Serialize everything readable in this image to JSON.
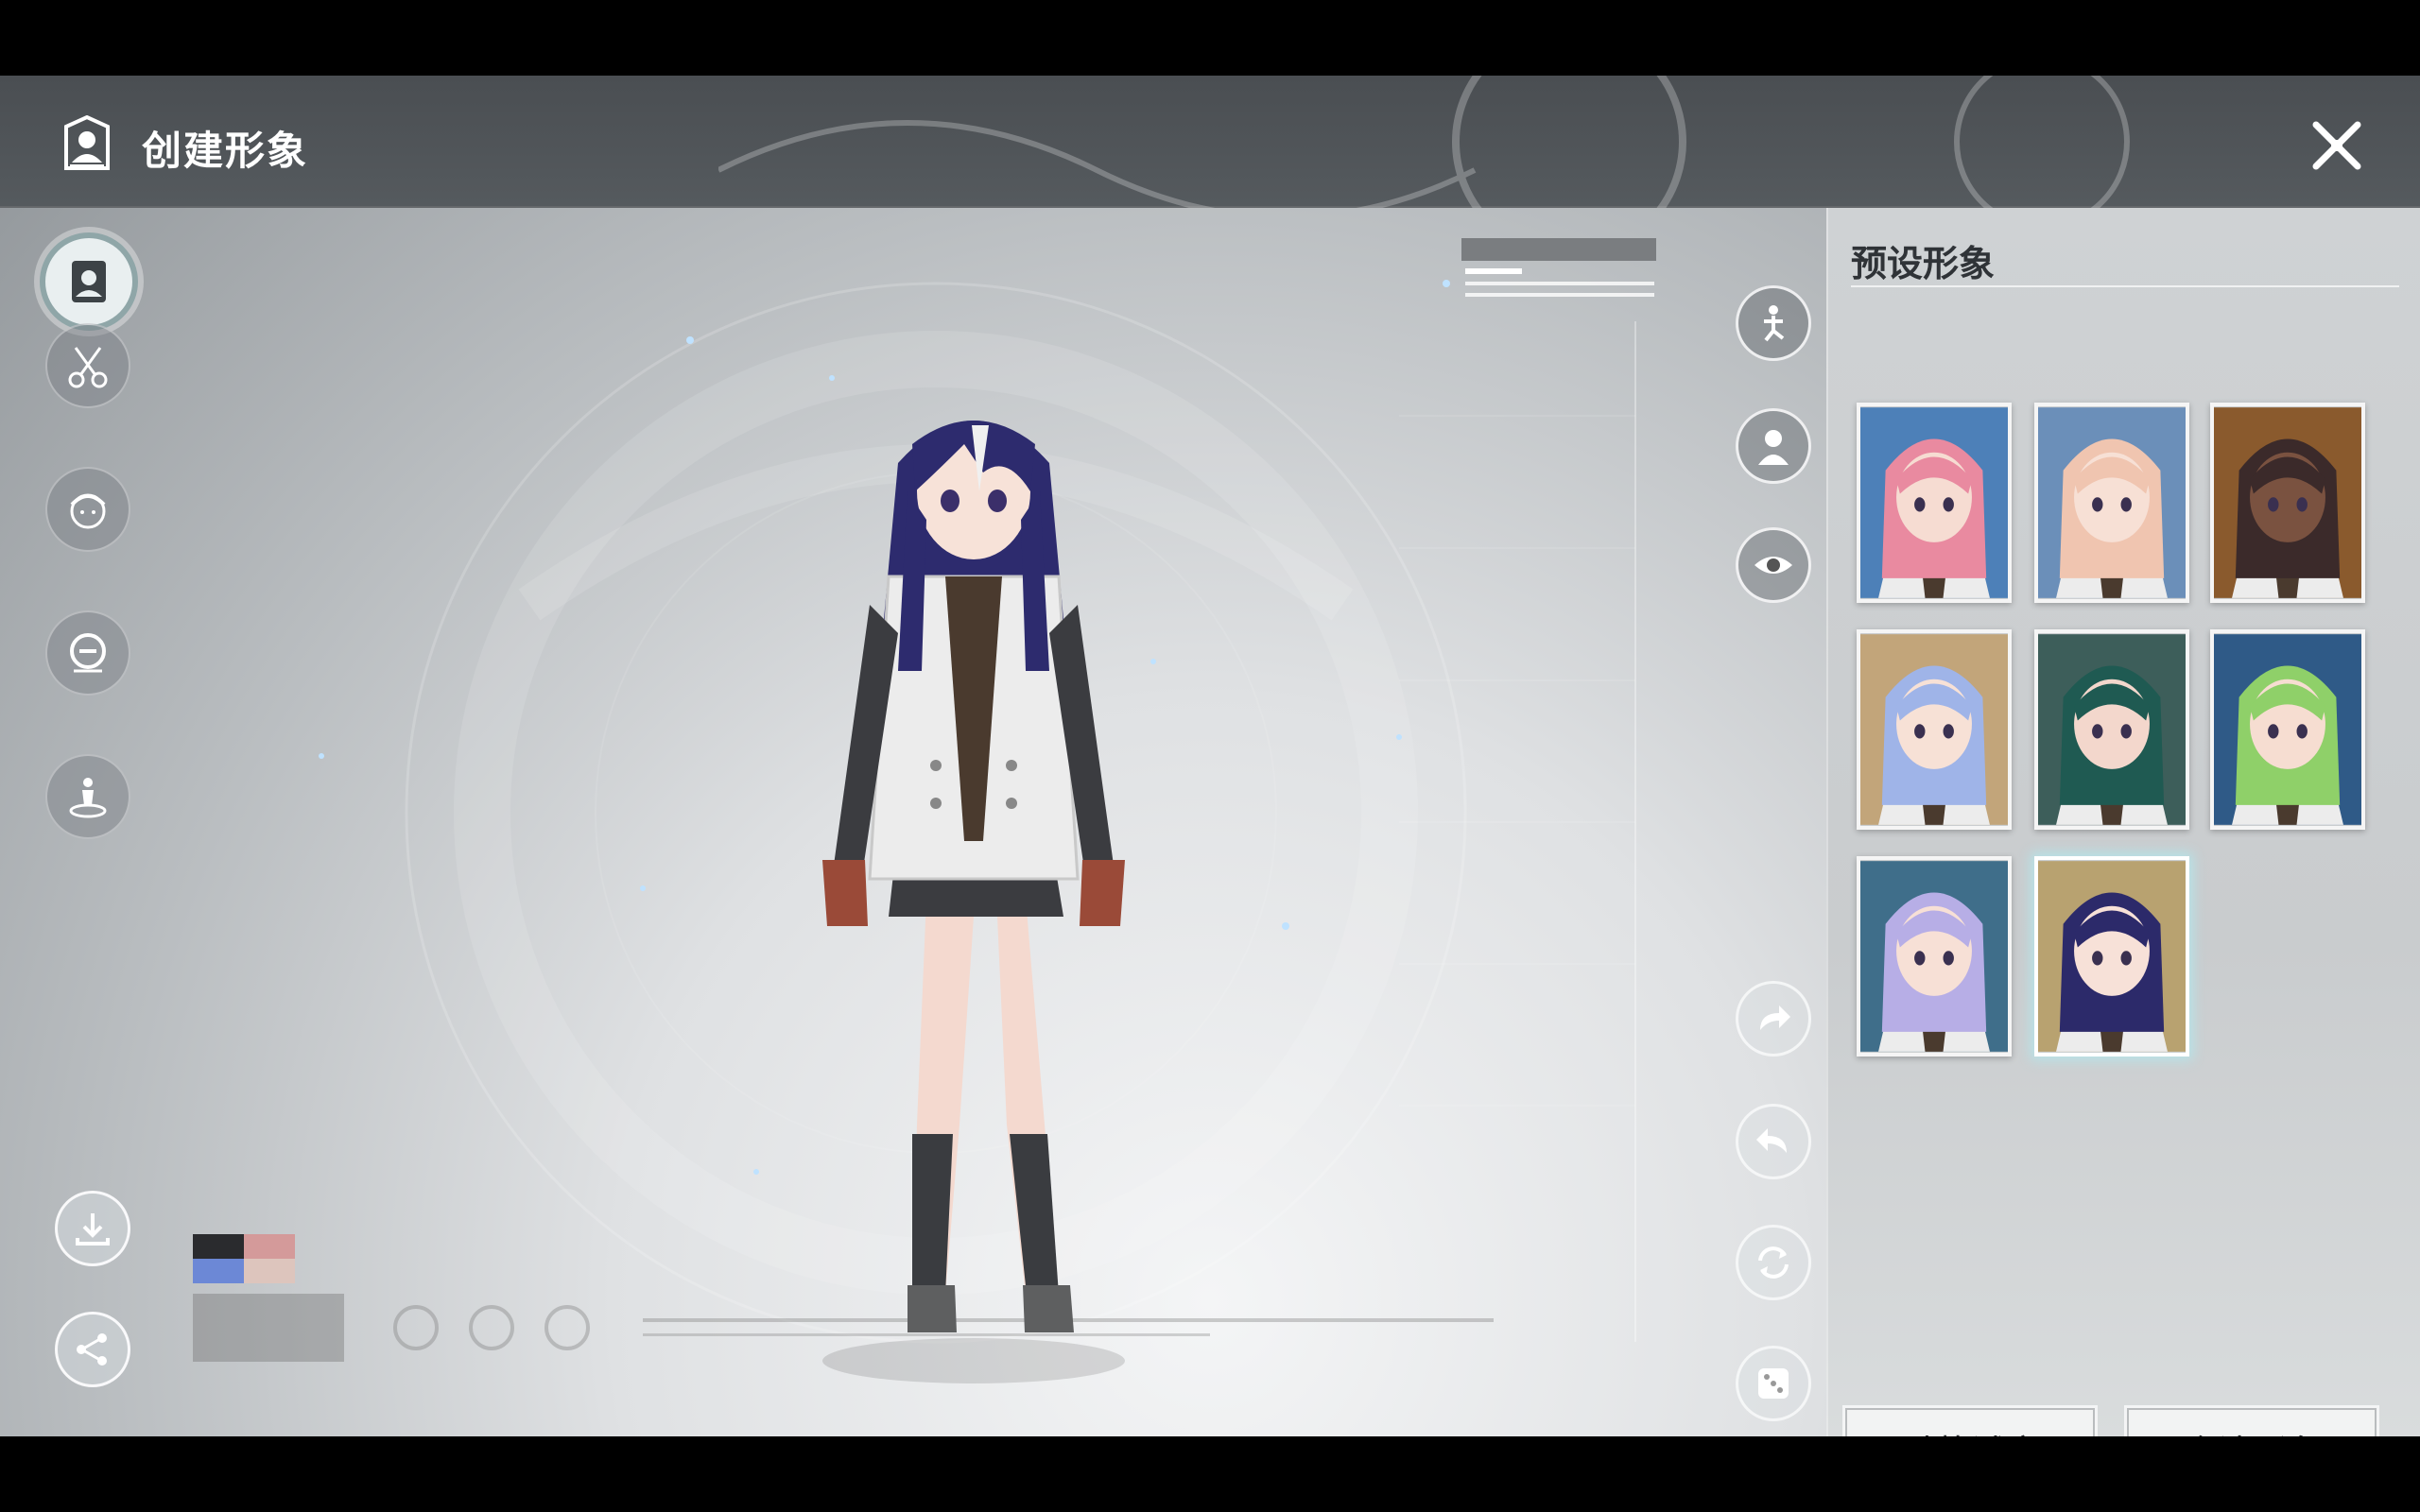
{
  "header": {
    "title": "创建形象",
    "app_icon": "character-card-icon",
    "close_icon": "close-x-icon"
  },
  "left_nav": [
    {
      "id": "preset",
      "icon": "portrait-card-icon",
      "active": true
    },
    {
      "id": "hairstyle",
      "icon": "scissors-icon",
      "active": false
    },
    {
      "id": "face",
      "icon": "face-icon",
      "active": false
    },
    {
      "id": "makeup",
      "icon": "compact-icon",
      "active": false
    },
    {
      "id": "body",
      "icon": "figure-pedestal-icon",
      "active": false
    }
  ],
  "left_bottom": [
    {
      "id": "download",
      "icon": "download-icon"
    },
    {
      "id": "share",
      "icon": "share-icon"
    }
  ],
  "tools": [
    {
      "id": "pose",
      "icon": "pose-icon"
    },
    {
      "id": "bust",
      "icon": "bust-icon"
    },
    {
      "id": "view",
      "icon": "eye-icon"
    },
    {
      "id": "redo",
      "icon": "redo-icon"
    },
    {
      "id": "undo",
      "icon": "undo-icon"
    },
    {
      "id": "reset",
      "icon": "reset-icon"
    },
    {
      "id": "random",
      "icon": "dice-icon"
    }
  ],
  "panel": {
    "title": "预设形象",
    "presets": [
      {
        "hair": "#e98aa0",
        "bg": "#4d80b8",
        "skin": "#f6dcd2",
        "selected": false
      },
      {
        "hair": "#f0c5b0",
        "bg": "#6b8fb9",
        "skin": "#f7e0d5",
        "selected": false
      },
      {
        "hair": "#3b2a2a",
        "bg": "#8a5a2d",
        "skin": "#7a5240",
        "selected": false
      },
      {
        "hair": "#9fb4e8",
        "bg": "#c2a57a",
        "skin": "#f7e1d6",
        "selected": false
      },
      {
        "hair": "#1f5a52",
        "bg": "#3d5e5a",
        "skin": "#f3d7cc",
        "selected": false
      },
      {
        "hair": "#8fd069",
        "bg": "#2f5a87",
        "skin": "#f6ddd1",
        "selected": false
      },
      {
        "hair": "#b7aee6",
        "bg": "#3f6e8a",
        "skin": "#f7e0d6",
        "selected": false
      },
      {
        "hair": "#2c2a6a",
        "bg": "#b8a270",
        "skin": "#f7e1d8",
        "selected": true
      }
    ],
    "try_outfit_label": "时装试穿",
    "confirm_label": "确认形象"
  },
  "color_swatches": [
    "#2a2b2e",
    "#d49a9a",
    "#6c88d6",
    "#ddc5bd"
  ],
  "accent_colors": {
    "header_bg": "#4f5358",
    "panel_bg": "#cdd0d2",
    "selection_glow": "#b4e6eb"
  }
}
